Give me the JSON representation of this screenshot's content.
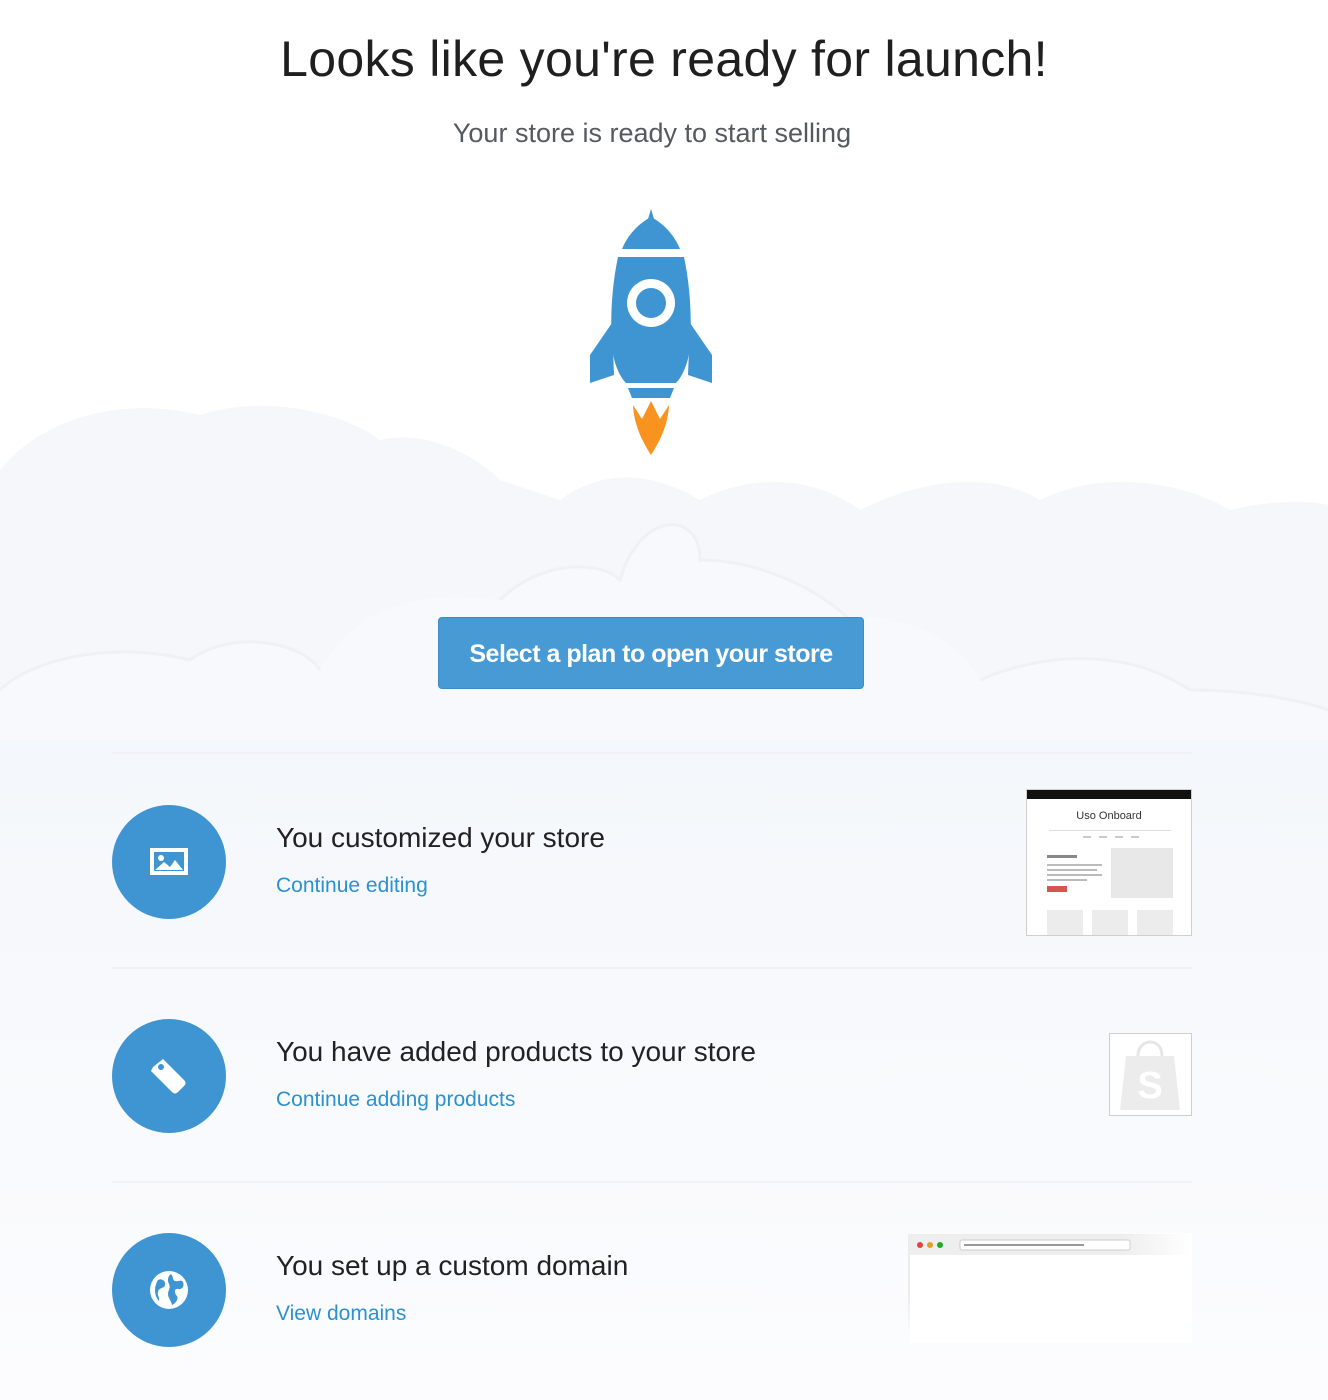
{
  "hero": {
    "title": "Looks like you're ready for launch!",
    "subtitle": "Your store is ready to start selling"
  },
  "cta": {
    "label": "Select a plan to open your store"
  },
  "tasks": [
    {
      "title": "You customized your store",
      "link": "Continue editing",
      "icon": "image-icon"
    },
    {
      "title": "You have added products to your store",
      "link": "Continue adding products",
      "icon": "tag-icon"
    },
    {
      "title": "You set up a custom domain",
      "link": "View domains",
      "icon": "globe-icon"
    }
  ],
  "thumbnails": {
    "theme_store_name": "Uso Onboard"
  },
  "colors": {
    "accent": "#3f95d2",
    "button": "#479ad4",
    "link": "#2b91cf",
    "flame": "#f7931e"
  }
}
